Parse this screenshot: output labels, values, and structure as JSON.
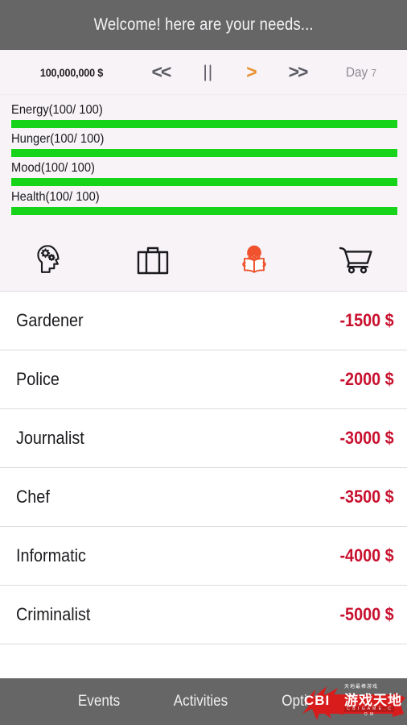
{
  "header": {
    "title": "Welcome! here are your needs..."
  },
  "control_bar": {
    "money": "100,000,000 $",
    "rewind_label": "<<",
    "pause_label": "||",
    "play_label": ">",
    "fastforward_label": ">>",
    "day_word": "Day",
    "day_number": "7",
    "active_control": "play",
    "active_color": "#e8912e"
  },
  "needs": [
    {
      "label": "Energy(100/ 100)",
      "current": 100,
      "max": 100,
      "percent": 100,
      "color": "#17d41a"
    },
    {
      "label": "Hunger(100/ 100)",
      "current": 100,
      "max": 100,
      "percent": 100,
      "color": "#17d41a"
    },
    {
      "label": "Mood(100/ 100)",
      "current": 100,
      "max": 100,
      "percent": 100,
      "color": "#17d41a"
    },
    {
      "label": "Health(100/ 100)",
      "current": 100,
      "max": 100,
      "percent": 100,
      "color": "#17d41a"
    }
  ],
  "icon_tabs": [
    {
      "icon": "head-gears-icon",
      "active": false,
      "color": "#1b1b1f"
    },
    {
      "icon": "briefcase-icon",
      "active": false,
      "color": "#1b1b1f"
    },
    {
      "icon": "person-reading-book-icon",
      "active": true,
      "color": "#ef522c"
    },
    {
      "icon": "shopping-cart-icon",
      "active": false,
      "color": "#1b1b1f"
    }
  ],
  "list": {
    "rows": [
      {
        "name": "Gardener",
        "price": "-1500 $"
      },
      {
        "name": "Police",
        "price": "-2000 $"
      },
      {
        "name": "Journalist",
        "price": "-3000 $"
      },
      {
        "name": "Chef",
        "price": "-3500 $"
      },
      {
        "name": "Informatic",
        "price": "-4000 $"
      },
      {
        "name": "Criminalist",
        "price": "-5000 $"
      }
    ],
    "price_color": "#c8102e"
  },
  "bottom_nav": {
    "items": [
      {
        "label": "Events"
      },
      {
        "label": "Activities"
      },
      {
        "label": "Options"
      }
    ]
  },
  "watermark": {
    "brand": "CBI",
    "chinese": "游戏天地",
    "top_small": "天地最棒游戏",
    "bar_text": "C B I G A M E . C O M",
    "color": "#d81c1c"
  }
}
